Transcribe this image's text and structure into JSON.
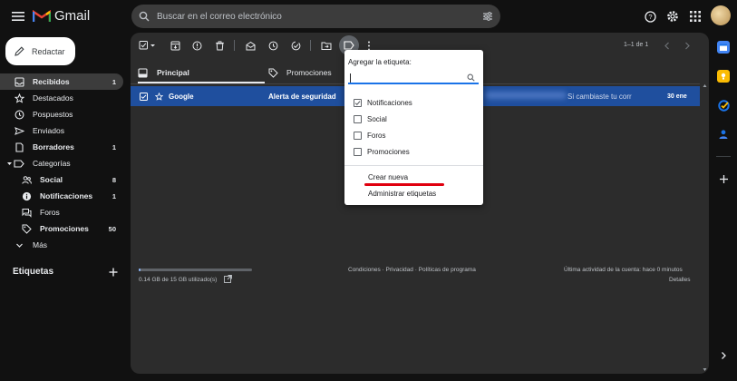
{
  "app": {
    "name": "Gmail"
  },
  "search": {
    "placeholder": "Buscar en el correo electrónico"
  },
  "compose": {
    "label": "Redactar"
  },
  "sidebar": {
    "items": [
      {
        "label": "Recibidos",
        "count": "1"
      },
      {
        "label": "Destacados",
        "count": ""
      },
      {
        "label": "Pospuestos",
        "count": ""
      },
      {
        "label": "Enviados",
        "count": ""
      },
      {
        "label": "Borradores",
        "count": "1"
      },
      {
        "label": "Categorías",
        "count": ""
      },
      {
        "label": "Social",
        "count": "8"
      },
      {
        "label": "Notificaciones",
        "count": "1"
      },
      {
        "label": "Foros",
        "count": ""
      },
      {
        "label": "Promociones",
        "count": "50"
      },
      {
        "label": "Más",
        "count": ""
      }
    ],
    "labels_heading": "Etiquetas"
  },
  "toolbar": {
    "pager": "1–1 de 1"
  },
  "tabs": [
    {
      "label": "Principal"
    },
    {
      "label": "Promociones"
    }
  ],
  "email": {
    "sender": "Google",
    "subject": "Alerta de seguridad",
    "snippet": "Si cambiaste tu corr",
    "date": "30 ene"
  },
  "footer": {
    "storage": "0.14 GB de 15 GB utilizado(s)",
    "storage_used_fraction": 0.009,
    "links": "Condiciones · Privacidad · Políticas de programa",
    "activity": "Última actividad de la cuenta: hace 0 minutos",
    "details": "Detalles"
  },
  "label_menu": {
    "title": "Agregar la etiqueta:",
    "search_value": "",
    "options": [
      {
        "label": "Notificaciones",
        "checked": true
      },
      {
        "label": "Social",
        "checked": false
      },
      {
        "label": "Foros",
        "checked": false
      },
      {
        "label": "Promociones",
        "checked": false
      }
    ],
    "create_new": "Crear nueva",
    "manage": "Administrar etiquetas"
  },
  "colors": {
    "background": "#111111",
    "panel": "#2c2c2c",
    "selected_row": "#1f4f9e",
    "accent": "#1a73e8",
    "annotation_red": "#e0000f"
  }
}
